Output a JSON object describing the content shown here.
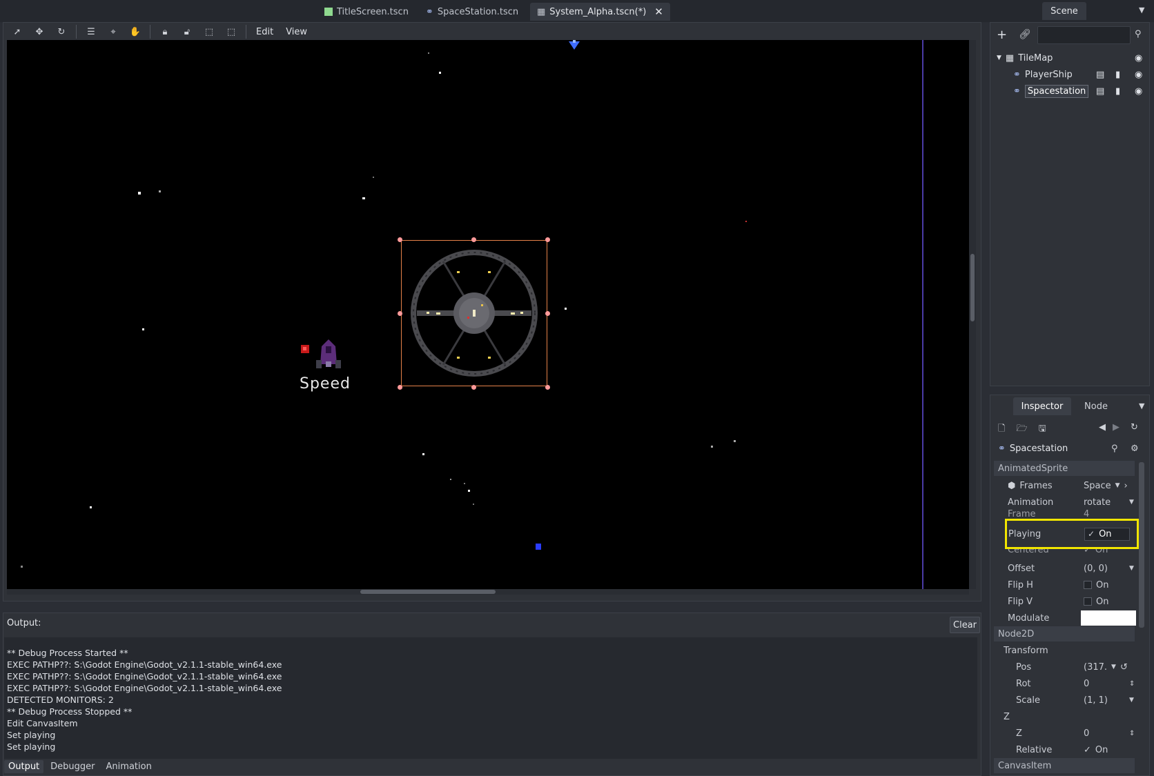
{
  "tabs": [
    {
      "label": "TitleScreen.tscn",
      "icon": "scene-icon"
    },
    {
      "label": "SpaceStation.tscn",
      "icon": "link-scene-icon"
    },
    {
      "label": "System_Alpha.tscn(*)",
      "icon": "tilemap-icon",
      "active": true
    }
  ],
  "scene_dock": {
    "title": "Scene"
  },
  "viewport": {
    "menus": {
      "edit": "Edit",
      "view": "View"
    },
    "speed_label": "Speed"
  },
  "scene_tree": [
    {
      "label": "TileMap",
      "icon": "tilemap-icon"
    },
    {
      "label": "PlayerShip",
      "icon": "link-scene-icon"
    },
    {
      "label": "Spacestation",
      "icon": "link-scene-icon",
      "selected": true
    }
  ],
  "inspector": {
    "tabs": {
      "inspector": "Inspector",
      "node": "Node"
    },
    "node_name": "Spacestation",
    "sections": {
      "animated_sprite": "AnimatedSprite",
      "node2d": "Node2D",
      "canvas_item": "CanvasItem"
    },
    "props": {
      "frames": {
        "name": "Frames",
        "value": "Space"
      },
      "animation": {
        "name": "Animation",
        "value": "rotate"
      },
      "frame": {
        "name": "Frame",
        "value": "4"
      },
      "playing": {
        "name": "Playing",
        "value": "On"
      },
      "centered": {
        "name": "Centered",
        "value": "On"
      },
      "offset": {
        "name": "Offset",
        "value": "(0, 0)"
      },
      "flip_h": {
        "name": "Flip H",
        "value": "On"
      },
      "flip_v": {
        "name": "Flip V",
        "value": "On"
      },
      "modulate": {
        "name": "Modulate"
      },
      "transform": {
        "name": "Transform"
      },
      "pos": {
        "name": "Pos",
        "value": "(317."
      },
      "rot": {
        "name": "Rot",
        "value": "0"
      },
      "scale": {
        "name": "Scale",
        "value": "(1, 1)"
      },
      "z_group": {
        "name": "Z"
      },
      "z": {
        "name": "Z",
        "value": "0"
      },
      "relative": {
        "name": "Relative",
        "value": "On"
      }
    }
  },
  "output": {
    "title": "Output:",
    "clear": "Clear",
    "lines": "** Debug Process Started **\nEXEC PATHP??: S:\\Godot Engine\\Godot_v2.1.1-stable_win64.exe\nEXEC PATHP??: S:\\Godot Engine\\Godot_v2.1.1-stable_win64.exe\nEXEC PATHP??: S:\\Godot Engine\\Godot_v2.1.1-stable_win64.exe\nDETECTED MONITORS: 2\n** Debug Process Stopped **\nEdit CanvasItem\nSet playing\nSet playing",
    "tabs": {
      "output": "Output",
      "debugger": "Debugger",
      "animation": "Animation"
    }
  },
  "colors": {
    "accent_highlight": "#f2e600",
    "selection": "#e8834a",
    "editor_bg": "#2f3238"
  }
}
